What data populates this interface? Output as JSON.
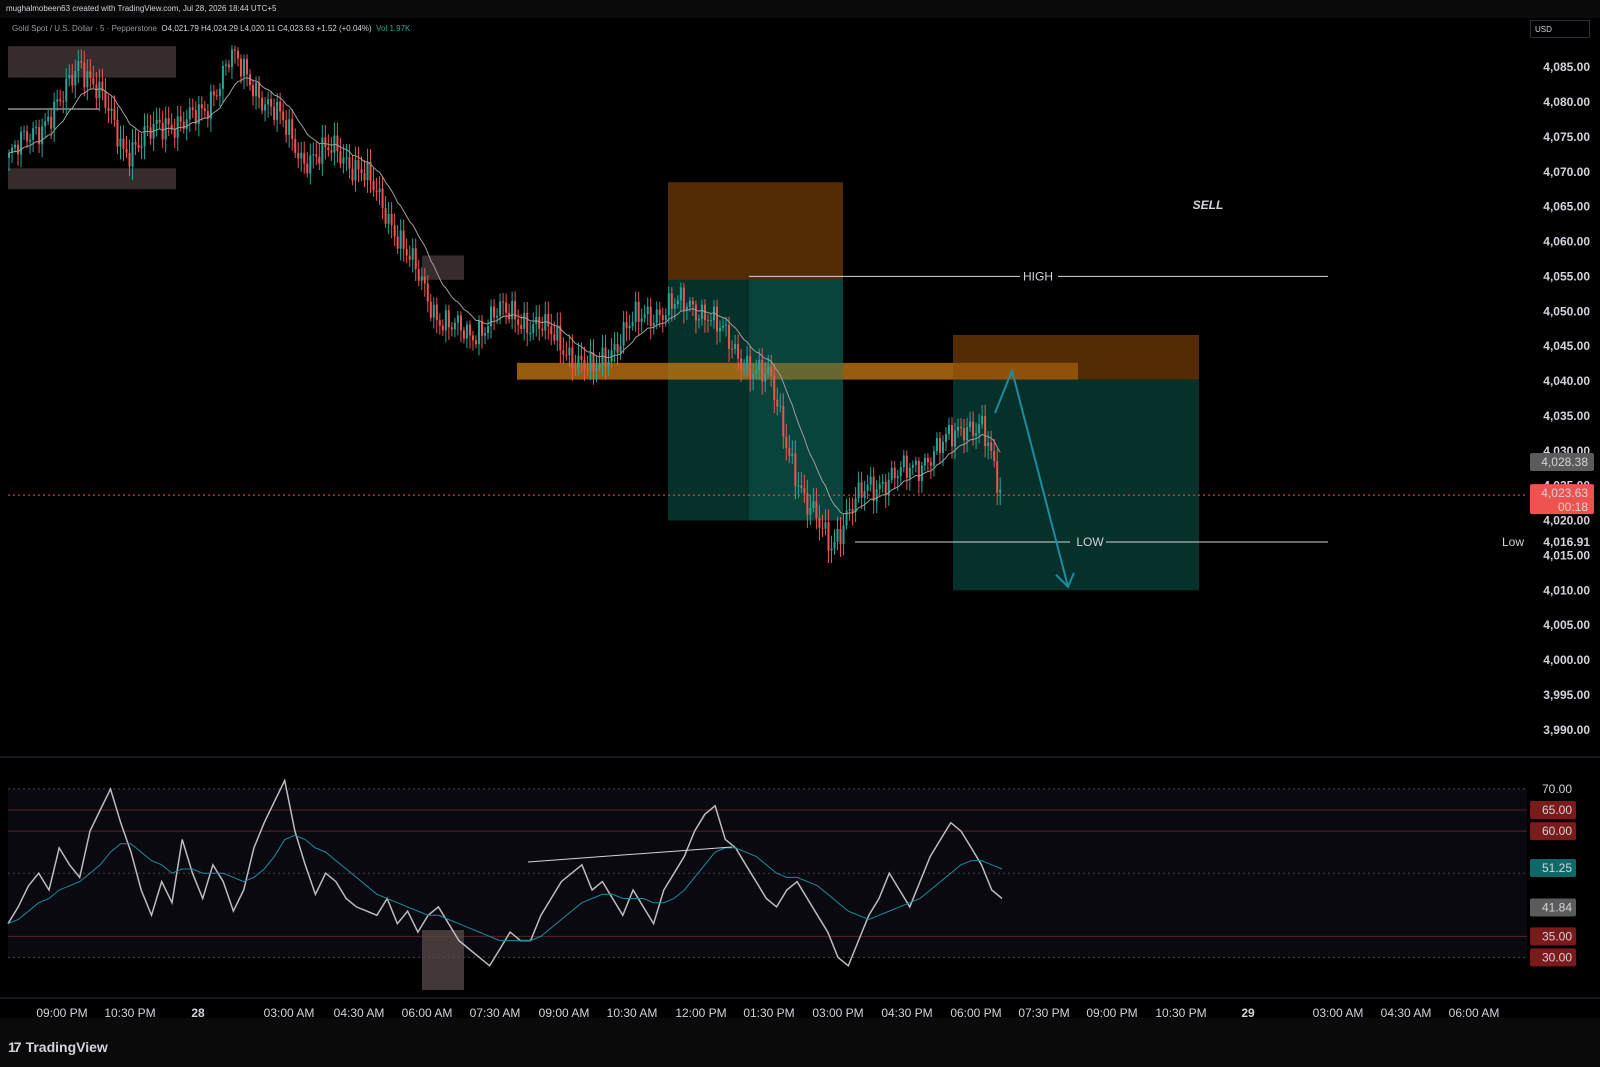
{
  "header": {
    "creator": "mughalmobeen63 created with TradingView.com, Jul 28, 2026 18:44 UTC+5",
    "symbol": "Gold Spot / U.S. Dollar · 5 · Pepperstone",
    "ohlc": "O4,021.79 H4,024.29 L4,020.11 C4,023.63 +1.52 (+0.04%)",
    "volume": "Vol 1.97K"
  },
  "axis": {
    "currency": "USD"
  },
  "chart_data": [
    {
      "type": "candlestick",
      "title": "Gold Spot / U.S. Dollar · 5 · Pepperstone",
      "y_ticks": [
        "4,085.00",
        "4,080.00",
        "4,075.00",
        "4,070.00",
        "4,065.00",
        "4,060.00",
        "4,055.00",
        "4,050.00",
        "4,045.00",
        "4,040.00",
        "4,035.00",
        "4,030.00",
        "4,025.00",
        "4,020.00",
        "4,015.00",
        "4,010.00",
        "4,005.00",
        "4,000.00",
        "3,995.00",
        "3,990.00"
      ],
      "ylim": [
        3987,
        4090
      ],
      "x_ticks": [
        "09:00 PM",
        "10:30 PM",
        "28",
        "03:00 AM",
        "04:30 AM",
        "06:00 AM",
        "07:30 AM",
        "09:00 AM",
        "10:30 AM",
        "12:00 PM",
        "01:30 PM",
        "03:00 PM",
        "04:30 PM",
        "06:00 PM",
        "07:30 PM",
        "09:00 PM",
        "10:30 PM",
        "29",
        "03:00 AM",
        "04:30 AM",
        "06:00 AM"
      ],
      "price_path": [
        [
          0,
          4072
        ],
        [
          0.03,
          4076
        ],
        [
          0.06,
          4080
        ],
        [
          0.08,
          4086
        ],
        [
          0.1,
          4082
        ],
        [
          0.13,
          4073
        ],
        [
          0.18,
          4077
        ],
        [
          0.22,
          4078
        ],
        [
          0.25,
          4087
        ],
        [
          0.27,
          4083
        ],
        [
          0.3,
          4079
        ],
        [
          0.33,
          4072
        ],
        [
          0.37,
          4073
        ],
        [
          0.4,
          4070
        ],
        [
          0.44,
          4061
        ],
        [
          0.48,
          4050
        ],
        [
          0.52,
          4046
        ],
        [
          0.55,
          4050
        ],
        [
          0.6,
          4048
        ],
        [
          0.66,
          4041
        ],
        [
          0.7,
          4048
        ],
        [
          0.75,
          4051
        ],
        [
          0.79,
          4050
        ],
        [
          0.82,
          4044
        ],
        [
          0.86,
          4040
        ],
        [
          0.9,
          4022
        ],
        [
          0.93,
          4017
        ],
        [
          0.97,
          4025
        ],
        [
          1.0,
          4026
        ],
        [
          1.05,
          4030
        ],
        [
          1.08,
          4034
        ],
        [
          1.1,
          4033
        ],
        [
          1.12,
          4024
        ]
      ],
      "last_price": "4,023.63",
      "countdown": "00:18",
      "ema_price": "4,028.38",
      "low_marker": "4,016.91",
      "labels": {
        "sell": "SELL",
        "high": "HIGH",
        "low": "LOW",
        "low_side": "Low"
      },
      "levels": {
        "high": 4055.0,
        "low": 4016.91,
        "current": 4023.63
      },
      "zones": [
        {
          "kind": "supply",
          "color": "#5a4a4a",
          "from": 4083.5,
          "to": 4088
        },
        {
          "kind": "supply",
          "color": "#5a4a4a",
          "from": 4067.5,
          "to": 4070.5
        },
        {
          "kind": "supply",
          "color": "#5a4a4a",
          "from": 4054.5,
          "to": 4058
        },
        {
          "kind": "stop",
          "color": "#8a4a0a",
          "from": 4054.5,
          "to": 4068.5
        },
        {
          "kind": "target",
          "color": "#0e6a5e",
          "from": 4020,
          "to": 4054.5
        },
        {
          "kind": "order-block",
          "color": "#c87a10",
          "from": 4040.2,
          "to": 4042.6
        },
        {
          "kind": "stop",
          "color": "#8a4a0a",
          "from": 4040.2,
          "to": 4046.6
        },
        {
          "kind": "target",
          "color": "#0e6a5e",
          "from": 4010,
          "to": 4040.2
        }
      ],
      "projection": [
        [
          4041.5
        ],
        [
          4010.5
        ]
      ]
    },
    {
      "type": "line",
      "title": "RSI",
      "y_ticks": [
        "70.00",
        "65.00",
        "60.00",
        "51.25",
        "41.84",
        "35.00",
        "30.00"
      ],
      "ylim": [
        24,
        76
      ],
      "levels": [
        70,
        65,
        60,
        50,
        35,
        30
      ],
      "series": [
        {
          "color": "#bdbdbd",
          "values": [
            38,
            42,
            47,
            50,
            46,
            56,
            52,
            49,
            60,
            65,
            70,
            62,
            55,
            46,
            40,
            48,
            43,
            58,
            50,
            44,
            52,
            48,
            41,
            46,
            56,
            62,
            67,
            72,
            60,
            52,
            45,
            50,
            48,
            44,
            42,
            41,
            40,
            44,
            38,
            41,
            36,
            40,
            42,
            38,
            34,
            32,
            30,
            28,
            32,
            36,
            34,
            34,
            40,
            44,
            48,
            50,
            52,
            46,
            48,
            44,
            40,
            46,
            42,
            38,
            46,
            50,
            54,
            60,
            64,
            66,
            58,
            56,
            52,
            48,
            44,
            42,
            46,
            48,
            44,
            40,
            36,
            30,
            28,
            34,
            40,
            44,
            50,
            46,
            42,
            48,
            54,
            58,
            62,
            60,
            56,
            52,
            46,
            44
          ]
        },
        {
          "color": "#1e8ca0",
          "values": [
            38,
            39,
            41,
            43,
            44,
            46,
            47,
            48,
            50,
            52,
            55,
            57,
            57,
            55,
            53,
            52,
            50,
            51,
            51,
            50,
            50,
            50,
            49,
            48,
            49,
            51,
            54,
            58,
            59,
            58,
            56,
            55,
            53,
            51,
            49,
            47,
            45,
            44,
            43,
            42,
            41,
            40,
            40,
            39,
            38,
            37,
            36,
            35,
            34,
            34,
            34,
            34,
            35,
            37,
            39,
            41,
            43,
            44,
            45,
            45,
            44,
            44,
            44,
            43,
            43,
            44,
            46,
            49,
            52,
            55,
            56,
            56,
            55,
            54,
            52,
            50,
            49,
            49,
            48,
            47,
            45,
            43,
            41,
            40,
            39,
            40,
            41,
            42,
            43,
            44,
            46,
            48,
            50,
            52,
            53,
            53,
            52,
            51
          ]
        }
      ]
    }
  ]
}
